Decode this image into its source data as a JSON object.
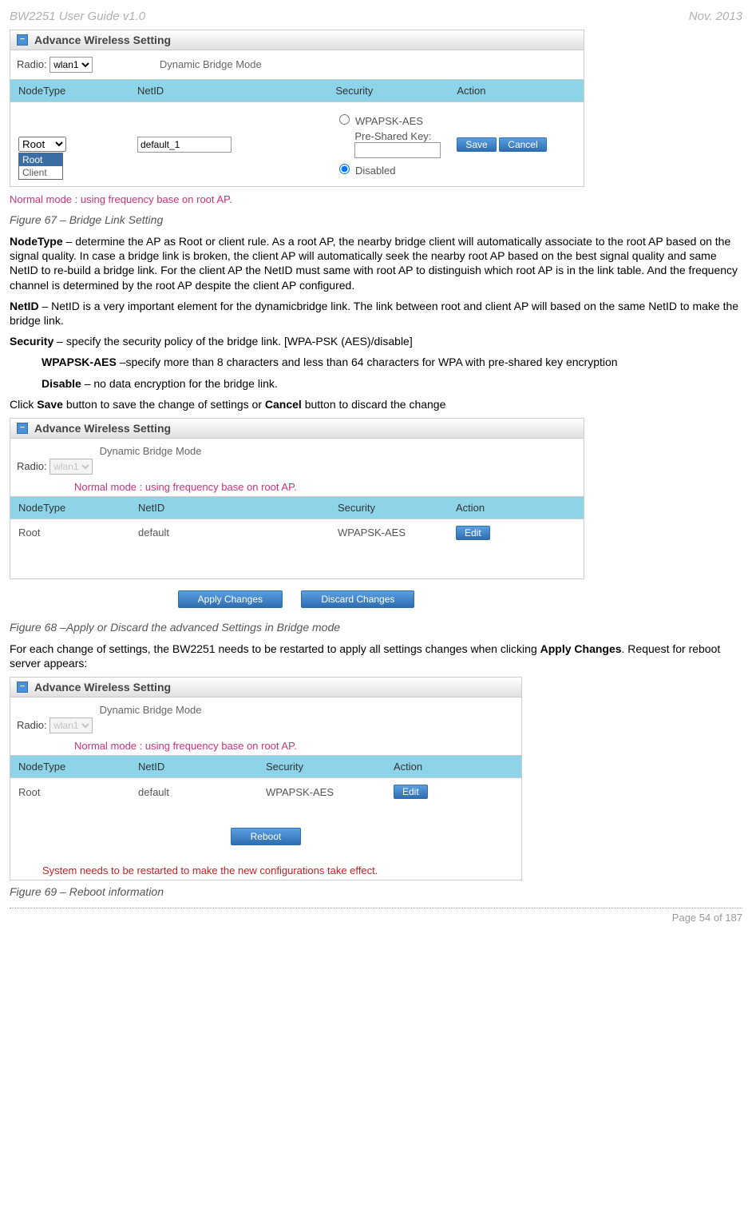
{
  "header": {
    "left": "BW2251 User Guide v1.0",
    "right": "Nov.  2013"
  },
  "panelTitle": "Advance Wireless Setting",
  "radioLabel": "Radio:",
  "radioValue": "wlan1",
  "modeLabel": "Dynamic Bridge Mode",
  "noteRed": "Normal mode : using frequency base on root AP.",
  "cols": {
    "c1": "NodeType",
    "c2": "NetID",
    "c3": "Security",
    "c4": "Action"
  },
  "panel1": {
    "nodeSelect": "Root",
    "dropdown": {
      "opt1": "Root",
      "opt2": "Client"
    },
    "netidValue": "default_1",
    "sec": {
      "wpa": "WPAPSK-AES",
      "pskLabel": "Pre-Shared Key:",
      "pskValue": "",
      "disabled": "Disabled"
    },
    "save": "Save",
    "cancel": "Cancel"
  },
  "fig67": "Figure 67 – Bridge Link Setting",
  "p1a": "NodeType",
  "p1b": " – determine the AP as Root or client rule. As a root AP, the nearby bridge client will automatically associate to the root AP based on the signal quality. In case a bridge link is broken, the client AP will automatically seek the nearby root AP based on the best signal quality and same NetID to re-build a bridge link. For the client AP the NetID must same with root AP to distinguish which root AP is in the link table. And the frequency channel is determined by the root AP despite the client AP configured.",
  "p2a": "NetID",
  "p2b": " – NetID is a very important element for the dynamicbridge link. The link between root and client AP will based on the same NetID to make the bridge link.",
  "p3a": "Security",
  "p3b": " – specify the security policy of the bridge link. [WPA-PSK (AES)/disable]",
  "p4a": "WPAPSK-AES",
  "p4b": " –specify more than 8 characters and less than 64 characters for WPA with pre-shared key encryption",
  "p5a": "Disable",
  "p5b": " – no data encryption for the bridge link.",
  "p6a": "Click ",
  "p6b": "Save",
  "p6c": " button to save the change of settings or ",
  "p6d": "Cancel",
  "p6e": " button to discard the change",
  "panel2": {
    "nodeType": "Root",
    "netid": "default",
    "security": "WPAPSK-AES",
    "edit": "Edit",
    "apply": "Apply Changes",
    "discard": "Discard Changes"
  },
  "fig68": "Figure 68 –Apply or Discard the advanced Settings in Bridge mode",
  "p7a": "For each change of settings, the BW2251 needs to be restarted to apply all settings changes when clicking ",
  "p7b": "Apply Changes",
  "p7c": ". Request for reboot server appears:",
  "panel3": {
    "reboot": "Reboot",
    "syswarn": "System needs to be restarted to make the new configurations take effect."
  },
  "fig69": "Figure 69 – Reboot information",
  "footer": "Page 54 of 187"
}
